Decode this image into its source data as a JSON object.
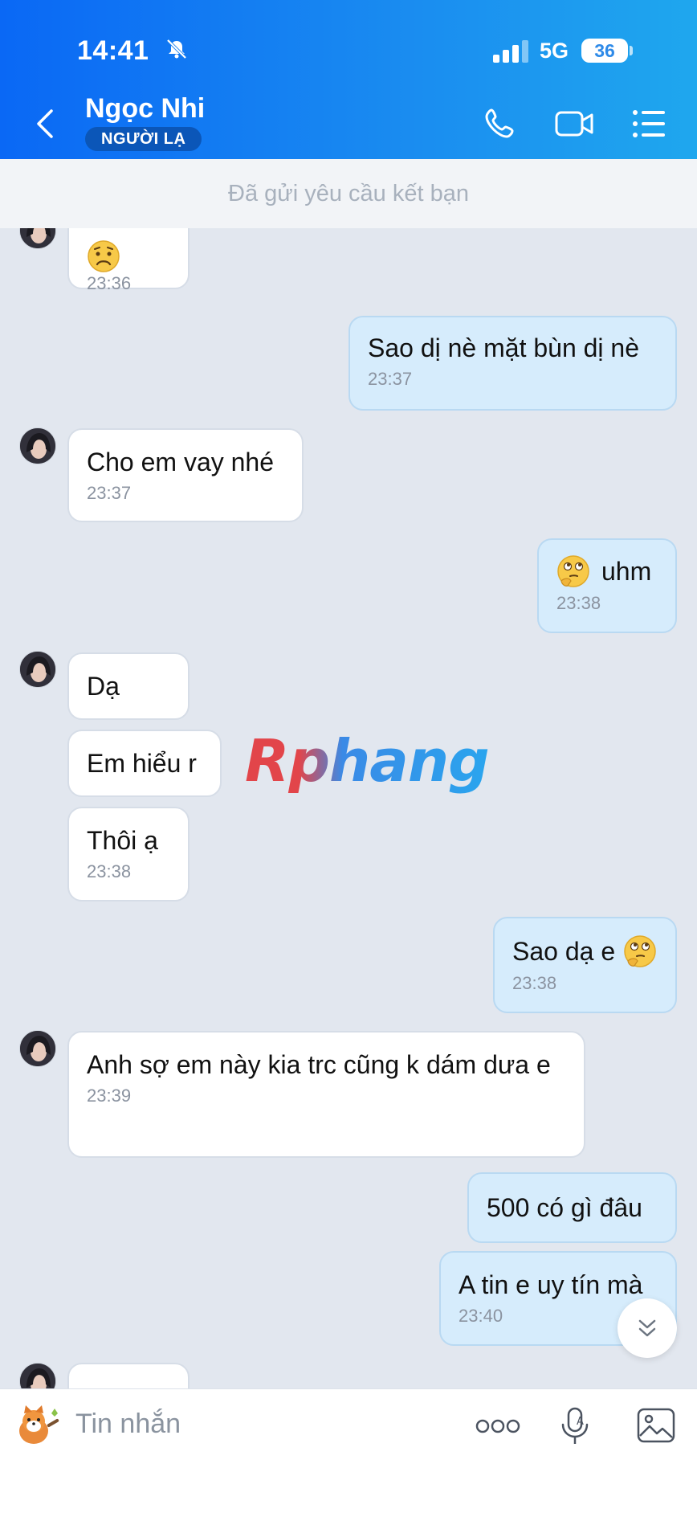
{
  "status_bar": {
    "time": "14:41",
    "network": "5G",
    "battery": "36"
  },
  "header": {
    "contact_name": "Ngọc Nhi",
    "badge": "NGƯỜI LẠ"
  },
  "friend_request_text": "Đã gửi yêu cầu kết bạn",
  "messages": [
    {
      "side": "in",
      "text": "",
      "emoji": "worried-face",
      "time": "23:36"
    },
    {
      "side": "out",
      "text": "Sao dị nè mặt bùn dị nè",
      "time": "23:37"
    },
    {
      "side": "in",
      "text": "Cho em vay nhé",
      "time": "23:37"
    },
    {
      "side": "out",
      "text": "uhm",
      "emoji": "thinking-face",
      "time": "23:38"
    },
    {
      "side": "in",
      "text": "Dạ"
    },
    {
      "side": "in",
      "text": "Em hiểu r"
    },
    {
      "side": "in",
      "text": "Thôi ạ",
      "time": "23:38"
    },
    {
      "side": "out",
      "text": "Sao dạ e",
      "emoji": "thinking-face",
      "time": "23:38"
    },
    {
      "side": "in",
      "text": "Anh sợ em này kia trc cũng k dám dưa e",
      "time": "23:39"
    },
    {
      "side": "out",
      "text": "500 có gì đâu"
    },
    {
      "side": "out",
      "text": "A tin e uy tín mà",
      "time": "23:40"
    }
  ],
  "watermark": "Rphang",
  "composer": {
    "placeholder": "Tin nhắn"
  },
  "colors": {
    "header_start": "#0a68f5",
    "header_end": "#1fa7ee",
    "outgoing_bubble": "#d6ecfc",
    "incoming_bubble": "#ffffff",
    "chat_background": "#e2e7ef"
  },
  "icons": [
    "bell-muted-icon",
    "back-icon",
    "phone-icon",
    "video-icon",
    "menu-icon",
    "chevron-down-icon",
    "sticker-icon",
    "more-icon",
    "mic-icon",
    "image-icon"
  ]
}
